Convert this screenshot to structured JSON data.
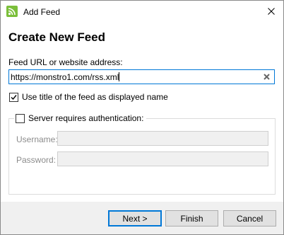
{
  "window": {
    "title": "Add Feed",
    "accent_color": "#0078d7",
    "icon": "rss-feed-icon"
  },
  "dialog": {
    "heading": "Create New Feed",
    "url_label": "Feed URL or website address:",
    "url_value": "https://monstro1.com/rss.xml",
    "use_title_label": "Use title of the feed as displayed name",
    "use_title_checked": true
  },
  "auth": {
    "group_label": "Server requires authentication:",
    "checked": false,
    "username_label": "Username:",
    "username_value": "",
    "password_label": "Password:",
    "password_value": ""
  },
  "buttons": {
    "next": "Next >",
    "finish": "Finish",
    "cancel": "Cancel"
  }
}
